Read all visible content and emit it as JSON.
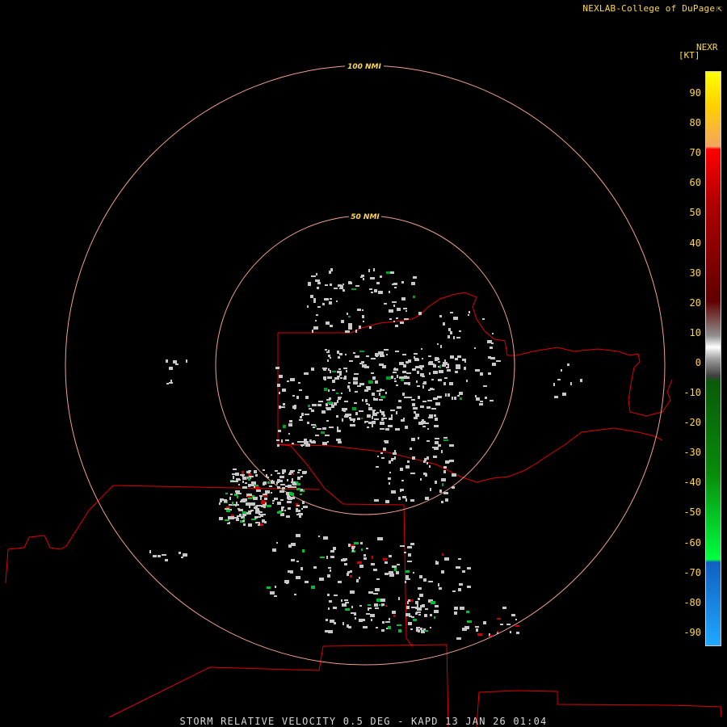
{
  "header": {
    "credit": "NEXLAB-College of DuPage",
    "credit_icon": "external-link-icon"
  },
  "map": {
    "rings": [
      {
        "label": "100 NMI",
        "radius_nmi": 100
      },
      {
        "label": "50 NMI",
        "radius_nmi": 50
      }
    ],
    "ring_color": "#f0a090",
    "border_color": "#e00000"
  },
  "legend": {
    "title": "NEXR",
    "unit": "[KT]",
    "ticks": [
      "90",
      "80",
      "70",
      "60",
      "50",
      "40",
      "30",
      "20",
      "10",
      "0",
      "-10",
      "-20",
      "-30",
      "-40",
      "-50",
      "-60",
      "-70",
      "-80",
      "-90"
    ],
    "colors": {
      "yellow": "#ffff00",
      "orange": "#f4a460",
      "red": "#ff0000",
      "dark_red": "#600000",
      "gray": "#a0a0a0",
      "dark_green": "#0a5a0a",
      "green": "#00ff40",
      "blue": "#1060c0",
      "light_blue": "#20a8ff"
    }
  },
  "footer": {
    "product": "STORM RELATIVE VELOCITY 0.5 DEG - KAPD 13 JAN 26 01:04"
  }
}
